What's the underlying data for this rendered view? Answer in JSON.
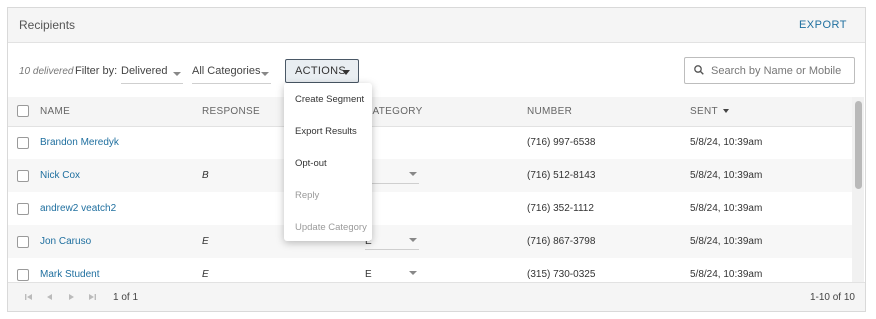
{
  "header": {
    "title": "Recipients",
    "export_label": "EXPORT"
  },
  "filters": {
    "delivered_count": "10 delivered",
    "filter_by_label": "Filter by:",
    "status_value": "Delivered",
    "category_value": "All Categories",
    "actions_label": "ACTIONS"
  },
  "search": {
    "placeholder": "Search by Name or Mobile",
    "value": ""
  },
  "table": {
    "columns": {
      "name": "NAME",
      "response": "RESPONSE",
      "category": "CATEGORY",
      "number": "NUMBER",
      "sent": "SENT"
    },
    "sort": {
      "column": "sent",
      "direction": "descending"
    },
    "rows": [
      {
        "name": "Brandon Meredyk",
        "response": "",
        "category": "",
        "number": "(716) 997-6538",
        "sent": "5/8/24, 10:39am"
      },
      {
        "name": "Nick Cox",
        "response": "B",
        "category": "B",
        "number": "(716) 512-8143",
        "sent": "5/8/24, 10:39am"
      },
      {
        "name": "andrew2 veatch2",
        "response": "",
        "category": "",
        "number": "(716) 352-1112",
        "sent": "5/8/24, 10:39am"
      },
      {
        "name": "Jon Caruso",
        "response": "E",
        "category": "E",
        "number": "(716) 867-3798",
        "sent": "5/8/24, 10:39am"
      },
      {
        "name": "Mark Student",
        "response": "E",
        "category": "E",
        "number": "(315) 730-0325",
        "sent": "5/8/24, 10:39am"
      }
    ]
  },
  "actions_menu": {
    "items": [
      {
        "label": "Create Segment",
        "disabled": false
      },
      {
        "label": "Export Results",
        "disabled": false
      },
      {
        "label": "Opt-out",
        "disabled": false
      },
      {
        "label": "Reply",
        "disabled": true
      },
      {
        "label": "Update Category",
        "disabled": true
      }
    ]
  },
  "footer": {
    "page_info": "1 of 1",
    "range_info": "1-10 of 10"
  },
  "colors": {
    "link": "#1f6f9f",
    "header_bg": "#f5f5f5",
    "actions_border": "#4a5866",
    "disabled_text": "#9a9a9a"
  }
}
